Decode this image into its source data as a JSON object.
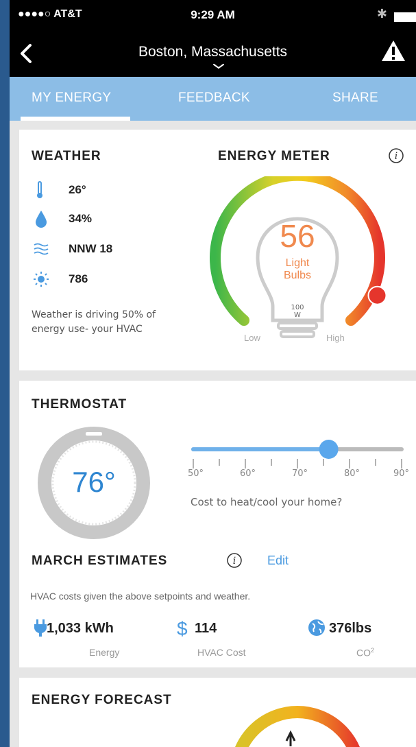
{
  "status_bar": {
    "carrier": "●●●●○ AT&T",
    "time": "9:29 AM",
    "bluetooth_icon": "bluetooth-icon"
  },
  "nav": {
    "title": "Boston, Massachusetts",
    "back_icon": "chevron-left-icon",
    "alert_icon": "warning-triangle-icon"
  },
  "tabs": [
    {
      "label": "MY ENERGY",
      "active": true
    },
    {
      "label": "FEEDBACK",
      "active": false
    },
    {
      "label": "SHARE",
      "active": false
    }
  ],
  "weather": {
    "heading": "WEATHER",
    "temperature": "26°",
    "humidity": "34%",
    "wind": "NNW 18",
    "solar": "786",
    "note": "Weather is driving 50% of energy use- your HVAC"
  },
  "energy_meter": {
    "heading": "ENERGY METER",
    "value": "56",
    "unit_line1": "Light",
    "unit_line2": "Bulbs",
    "bulb_watt_line1": "100",
    "bulb_watt_line2": "W",
    "low_label": "Low",
    "high_label": "High",
    "level_fraction": 0.9
  },
  "thermostat": {
    "heading": "THERMOSTAT",
    "temperature": "76°",
    "slider_labels": [
      "50°",
      "60°",
      "70°",
      "80°",
      "90°"
    ],
    "slider_value": 76,
    "slider_min": 50,
    "slider_max": 90,
    "cost_question": "Cost to heat/cool your home?"
  },
  "estimates": {
    "heading": "MARCH ESTIMATES",
    "edit_label": "Edit",
    "description": "HVAC costs given the above setpoints and weather.",
    "energy_value": "1,033 kWh",
    "energy_label": "Energy",
    "cost_value": "114",
    "cost_symbol": "$",
    "cost_label": "HVAC Cost",
    "co2_value": "376lbs",
    "co2_label": "CO",
    "co2_sup": "2"
  },
  "forecast": {
    "heading": "ENERGY FORECAST"
  },
  "colors": {
    "accent_blue": "#8cbde6",
    "meter_orange": "#f0894e",
    "link_blue": "#4a9ae0",
    "thermo_blue": "#2f86d1"
  }
}
